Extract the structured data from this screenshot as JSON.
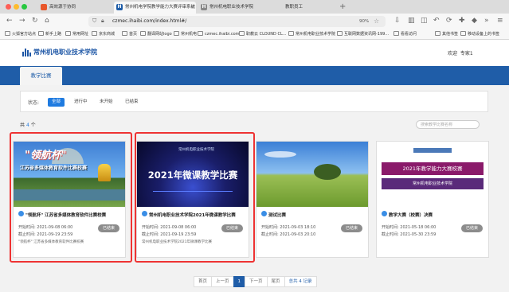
{
  "browser": {
    "tabs": [
      {
        "label": "高效源于协同"
      },
      {
        "label": "常州机电学院教学能力大赛评审系统"
      },
      {
        "label": "常州机电职业技术学院"
      },
      {
        "label": "教职员工"
      }
    ],
    "new_tab": "+",
    "url": "czmec.ihaibi.com/index.html#/",
    "zoom": "90%",
    "bookmarks": [
      "火狐官方站点",
      "新手上路",
      "常用网址",
      "京东商城",
      "首页",
      "翻译网站logo",
      "常州机电",
      "czmec.ihaibi.com",
      "职教云 CLOUND CL...",
      "常州机电职业技术学院",
      "互联网数据资讯网-199...",
      "看看访问"
    ],
    "bookmarks_right": [
      "其他书签",
      "移动设备上的书签"
    ]
  },
  "header": {
    "logo_text": "常州机电职业技术学院",
    "welcome": "欢迎",
    "user": "专家1"
  },
  "nav": {
    "tab_label": "教学比赛"
  },
  "filter": {
    "label": "状态:",
    "options": [
      "全部",
      "进行中",
      "未开始",
      "已结束"
    ],
    "selected": "全部"
  },
  "list": {
    "count_prefix": "共",
    "count": "4",
    "count_suffix": "个",
    "search_placeholder": "搜索教学比赛名称"
  },
  "cards": [
    {
      "title": "\"领航杯\" 江苏省多媒体教育软件比赛校赛",
      "start_label": "开始时间:",
      "start": "2021-09-08 06:00",
      "end_label": "截止时间:",
      "end": "2021-09-19 23:59",
      "desc": "\"领航杯\" 江苏省多媒体教育软件比赛校赛",
      "status": "已结束",
      "highlighted": true,
      "banner": "\"领航杯\"",
      "banner_sub": "江苏省多媒体教育软件比赛校赛"
    },
    {
      "title": "常州机电职业技术学院2021年微课教学比赛",
      "start_label": "开始时间:",
      "start": "2021-09-08 06:00",
      "end_label": "截止时间:",
      "end": "2021-09-19 23:59",
      "desc": "常州机电职业技术学院2021年微课教学比赛",
      "status": "已结束",
      "highlighted": true,
      "banner": "2021年微课教学比赛",
      "banner_sub": "常州机电职业技术学院"
    },
    {
      "title": "测试比赛",
      "start_label": "开始时间:",
      "start": "2021-09-03 18:10",
      "end_label": "截止时间:",
      "end": "2021-09-03 20:10",
      "desc": "",
      "status": "已结束",
      "highlighted": false
    },
    {
      "title": "教学大赛（校赛）决赛",
      "start_label": "开始时间:",
      "start": "2021-05-18 06:00",
      "end_label": "截止时间:",
      "end": "2021-05-30 23:59",
      "desc": "",
      "status": "已结束",
      "highlighted": false,
      "banner": "2021年教学能力大赛校赛",
      "banner_sub": "常州机电职业技术学院"
    }
  ],
  "pager": {
    "first": "首页",
    "prev": "上一页",
    "current": "1",
    "next": "下一页",
    "last": "尾页",
    "total": "总共 4 记录"
  }
}
